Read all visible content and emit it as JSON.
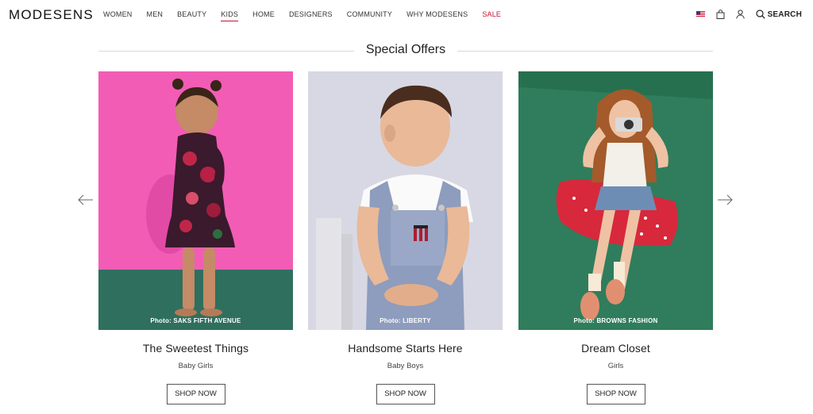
{
  "brand": {
    "logo": "MODESENS"
  },
  "nav": {
    "items": [
      {
        "label": "WOMEN"
      },
      {
        "label": "MEN"
      },
      {
        "label": "BEAUTY"
      },
      {
        "label": "KIDS"
      },
      {
        "label": "HOME"
      },
      {
        "label": "DESIGNERS"
      },
      {
        "label": "COMMUNITY"
      },
      {
        "label": "WHY MODESENS"
      },
      {
        "label": "SALE"
      }
    ],
    "active": "KIDS",
    "sale_color": "#c8102e"
  },
  "utils": {
    "flag_icon": "us-flag-icon",
    "bag_icon": "bag-icon",
    "user_icon": "user-icon",
    "search_icon": "search-icon",
    "search_label": "SEARCH"
  },
  "section": {
    "title": "Special Offers"
  },
  "carousel": {
    "prev_icon": "arrow-left-icon",
    "next_icon": "arrow-right-icon"
  },
  "cards": [
    {
      "credit": "Photo: SAKS FIFTH AVENUE",
      "title": "The Sweetest Things",
      "subtitle": "Baby Girls",
      "button": "SHOP NOW"
    },
    {
      "credit": "Photo: LIBERTY",
      "title": "Handsome Starts Here",
      "subtitle": "Baby Boys",
      "button": "SHOP NOW"
    },
    {
      "credit": "Photo: BROWNS FASHION",
      "title": "Dream Closet",
      "subtitle": "Girls",
      "button": "SHOP NOW"
    }
  ]
}
